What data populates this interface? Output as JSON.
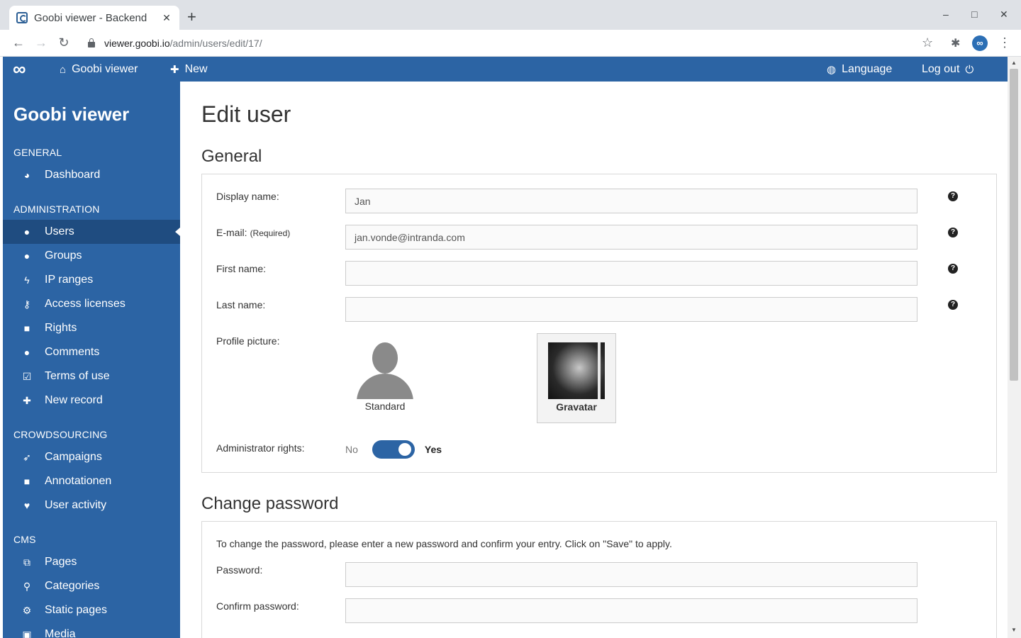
{
  "browser": {
    "tab_title": "Goobi viewer - Backend",
    "tab_close": "✕",
    "new_tab": "+",
    "url_host": "viewer.goobi.io",
    "url_path": "/admin/users/edit/17/",
    "window_controls": [
      "–",
      "□",
      "✕"
    ]
  },
  "topbar": {
    "logo": "∞",
    "home_label": "Goobi viewer",
    "new_label": "New",
    "language_label": "Language",
    "logout_label": "Log out"
  },
  "sidebar": {
    "title": "Goobi viewer",
    "sections": {
      "general": "GENERAL",
      "administration": "ADMINISTRATION",
      "crowdsourcing": "CROWDSOURCING",
      "cms": "CMS"
    },
    "items": [
      {
        "label": "Dashboard",
        "icon": "dashboard-icon",
        "glyph": "◕"
      },
      {
        "label": "Users",
        "icon": "user-icon",
        "glyph": "●",
        "active": true
      },
      {
        "label": "Groups",
        "icon": "group-icon",
        "glyph": "●"
      },
      {
        "label": "IP ranges",
        "icon": "bolt-icon",
        "glyph": "ϟ"
      },
      {
        "label": "Access licenses",
        "icon": "key-icon",
        "glyph": "⚷"
      },
      {
        "label": "Rights",
        "icon": "lock-icon",
        "glyph": "■"
      },
      {
        "label": "Comments",
        "icon": "comments-icon",
        "glyph": "●"
      },
      {
        "label": "Terms of use",
        "icon": "check-square-icon",
        "glyph": "☑"
      },
      {
        "label": "New record",
        "icon": "plus-icon",
        "glyph": "✚"
      },
      {
        "label": "Campaigns",
        "icon": "rocket-icon",
        "glyph": "➶"
      },
      {
        "label": "Annotationen",
        "icon": "sticky-note-icon",
        "glyph": "■"
      },
      {
        "label": "User activity",
        "icon": "heartbeat-icon",
        "glyph": "♥"
      },
      {
        "label": "Pages",
        "icon": "copy-icon",
        "glyph": "⧉"
      },
      {
        "label": "Categories",
        "icon": "thumbtack-icon",
        "glyph": "⚲"
      },
      {
        "label": "Static pages",
        "icon": "cogs-icon",
        "glyph": "⚙"
      },
      {
        "label": "Media",
        "icon": "image-icon",
        "glyph": "▣"
      }
    ]
  },
  "main": {
    "page_title": "Edit user",
    "general": {
      "heading": "General",
      "display_name_label": "Display name:",
      "display_name_value": "Jan",
      "email_label": "E-mail:",
      "email_required": "(Required)",
      "email_value": "jan.vonde@intranda.com",
      "first_name_label": "First name:",
      "first_name_value": "",
      "last_name_label": "Last name:",
      "last_name_value": "",
      "profile_picture_label": "Profile picture:",
      "standard_label": "Standard",
      "gravatar_label": "Gravatar",
      "admin_rights_label": "Administrator rights:",
      "toggle_no": "No",
      "toggle_yes": "Yes",
      "help_glyph": "?"
    },
    "password": {
      "heading": "Change password",
      "intro": "To change the password, please enter a new password and confirm your entry. Click on \"Save\" to apply.",
      "password_label": "Password:",
      "confirm_label": "Confirm password:"
    }
  },
  "colors": {
    "brand_blue": "#2c64a4",
    "active_item": "#1f4c80"
  }
}
